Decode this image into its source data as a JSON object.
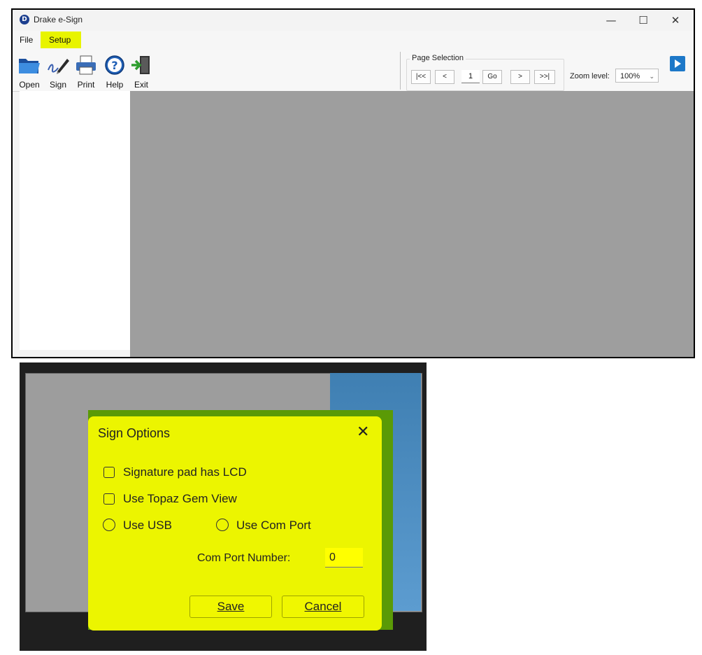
{
  "window": {
    "title": "Drake e-Sign",
    "controls": [
      "—",
      "☐",
      "✕"
    ]
  },
  "menu": {
    "file": "File",
    "setup": "Setup"
  },
  "toolbar": {
    "open": "Open",
    "sign": "Sign",
    "print": "Print",
    "help": "Help",
    "exit": "Exit"
  },
  "page_selection": {
    "label": "Page Selection",
    "first": "|<<",
    "prev": "<",
    "page": "1",
    "go": "Go",
    "next": ">",
    "last": ">>|",
    "zoom_label": "Zoom level:",
    "zoom_value": "100%"
  },
  "dialog": {
    "title": "Sign Options",
    "close": "✕",
    "options": {
      "lcd": "Signature pad has LCD",
      "gem": "Use Topaz Gem View",
      "usb": "Use USB",
      "com": "Use Com Port"
    },
    "com_port_label": "Com Port Number:",
    "com_port_value": "0",
    "save": "Save",
    "cancel": "Cancel"
  },
  "colors": {
    "highlight": "#e8f400",
    "dialog_bg": "#ecf500",
    "doc_area": "#9e9e9e",
    "accent": "#1d78c8"
  }
}
